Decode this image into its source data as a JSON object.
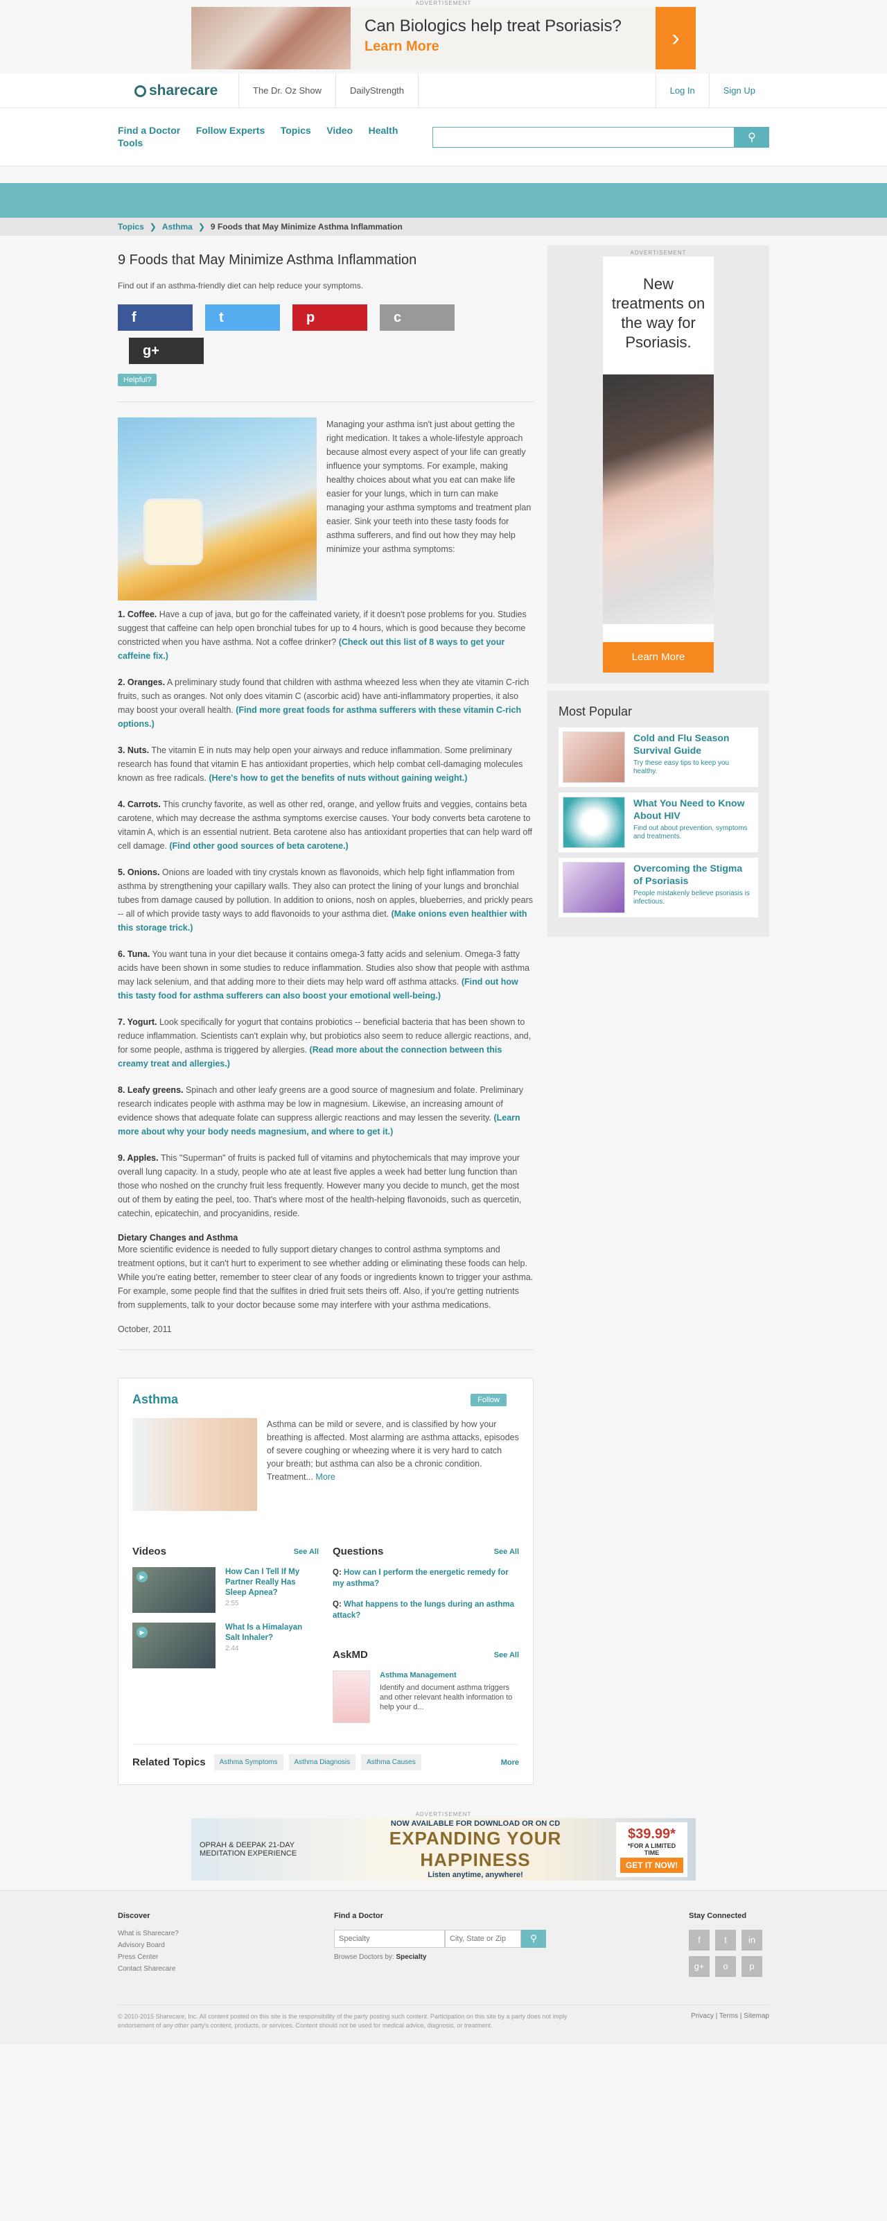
{
  "top_ad": {
    "tag": "ADVERTISEMENT",
    "headline": "Can Biologics help treat Psoriasis?",
    "cta": "Learn More",
    "arrow": "›"
  },
  "header": {
    "logo": "sharecare",
    "links": [
      "The Dr. Oz Show",
      "DailyStrength"
    ],
    "login": "Log In",
    "signup": "Sign Up"
  },
  "nav": {
    "items": [
      "Find a Doctor",
      "Follow Experts",
      "Topics",
      "Video",
      "Health Tools"
    ],
    "search_placeholder": "",
    "search_icon": "search-icon"
  },
  "breadcrumb": [
    "Topics",
    "Asthma",
    "9 Foods that May Minimize Asthma Inflammation"
  ],
  "article": {
    "title": "9 Foods that May Minimize Asthma Inflammation",
    "subtitle": "Find out if an asthma-friendly diet can help reduce your symptoms.",
    "share": {
      "facebook": "f",
      "twitter": "t",
      "pinterest": "p",
      "cc": "c",
      "gplus": "g+"
    },
    "helpful": "Helpful?",
    "intro": "Managing your asthma isn't just about getting the right medication. It takes a whole-lifestyle approach because almost every aspect of your life can greatly influence your symptoms. For example, making healthy choices about what you eat can make life easier for your lungs, which in turn can make managing your asthma symptoms and treatment plan easier. Sink your teeth into these tasty foods for asthma sufferers, and find out how they may help minimize your asthma symptoms:",
    "items": [
      {
        "head": "1. Coffee.",
        "text": " Have a cup of java, but go for the caffeinated variety, if it doesn't pose problems for you. Studies suggest that caffeine can help open bronchial tubes for up to 4 hours, which is good because they become constricted when you have asthma. Not a coffee drinker? ",
        "link": "(Check out this list of 8 ways to get your caffeine fix.)"
      },
      {
        "head": "2. Oranges.",
        "text": " A preliminary study found that children with asthma wheezed less when they ate vitamin C-rich fruits, such as oranges. Not only does vitamin C (ascorbic acid) have anti-inflammatory properties, it also may boost your overall health. ",
        "link": "(Find more great foods for asthma sufferers with these vitamin C-rich options.)"
      },
      {
        "head": "3. Nuts.",
        "text": " The vitamin E in nuts may help open your airways and reduce inflammation. Some preliminary research has found that vitamin E has antioxidant properties, which help combat cell-damaging molecules known as free radicals. ",
        "link": "(Here's how to get the benefits of nuts without gaining weight.)"
      },
      {
        "head": "4. Carrots.",
        "text": " This crunchy favorite, as well as other red, orange, and yellow fruits and veggies, contains beta carotene, which may decrease the asthma symptoms exercise causes. Your body converts beta carotene to vitamin A, which is an essential nutrient. Beta carotene also has antioxidant properties that can help ward off cell damage. ",
        "link": "(Find other good sources of beta carotene.)"
      },
      {
        "head": "5. Onions.",
        "text": " Onions are loaded with tiny crystals known as flavonoids, which help fight inflammation from asthma by strengthening your capillary walls. They also can protect the lining of your lungs and bronchial tubes from damage caused by pollution. In addition to onions, nosh on apples, blueberries, and prickly pears -- all of which provide tasty ways to add flavonoids to your asthma diet. ",
        "link": "(Make onions even healthier with this storage trick.)"
      },
      {
        "head": "6. Tuna.",
        "text": " You want tuna in your diet because it contains omega-3 fatty acids and selenium. Omega-3 fatty acids have been shown in some studies to reduce inflammation. Studies also show that people with asthma may lack selenium, and that adding more to their diets may help ward off asthma attacks. ",
        "link": "(Find out how this tasty food for asthma sufferers can also boost your emotional well-being.)"
      },
      {
        "head": "7. Yogurt.",
        "text": " Look specifically for yogurt that contains probiotics -- beneficial bacteria that has been shown to reduce inflammation. Scientists can't explain why, but probiotics also seem to reduce allergic reactions, and, for some people, asthma is triggered by allergies. ",
        "link": "(Read more about the connection between this creamy treat and allergies.)"
      },
      {
        "head": "8. Leafy greens.",
        "text": " Spinach and other leafy greens are a good source of magnesium and folate. Preliminary research indicates people with asthma may be low in magnesium. Likewise, an increasing amount of evidence shows that adequate folate can suppress allergic reactions and may lessen the severity. ",
        "link": "(Learn more about why your body needs magnesium, and where to get it.)"
      },
      {
        "head": "9. Apples.",
        "text": " This \"Superman\" of fruits is packed full of vitamins and phytochemicals that may improve your overall lung capacity. In a study, people who ate at least five apples a week had better lung function than those who noshed on the crunchy fruit less frequently. However many you decide to munch, get the most out of them by eating the peel, too. That's where most of the health-helping flavonoids, such as quercetin, catechin, epicatechin, and procyanidins, reside.",
        "link": ""
      }
    ],
    "dietary_head": "Dietary Changes and Asthma",
    "dietary_text": "More scientific evidence is needed to fully support dietary changes to control asthma symptoms and treatment options, but it can't hurt to experiment to see whether adding or eliminating these foods can help. While you're eating better, remember to steer clear of any foods or ingredients known to trigger your asthma. For example, some people find that the sulfites in dried fruit sets theirs off. Also, if you're getting nutrients from supplements, talk to your doctor because some may interfere with your asthma medications.",
    "date": "October, 2011"
  },
  "topic": {
    "title": "Asthma",
    "follow": "Follow",
    "desc": "Asthma can be mild or severe, and is classified by how your breathing is affected. Most alarming are asthma attacks, episodes of severe coughing or wheezing where it is very hard to catch your breath; but asthma can also be a chronic condition. Treatment...",
    "more": "More",
    "videos_head": "Videos",
    "see_all": "See All",
    "videos": [
      {
        "title": "How Can I Tell If My Partner Really Has Sleep Apnea?",
        "dur": "2:55"
      },
      {
        "title": "What Is a Himalayan Salt Inhaler?",
        "dur": "2:44"
      }
    ],
    "questions_head": "Questions",
    "questions": [
      "How can I perform the energetic remedy for my asthma?",
      "What happens to the lungs during an asthma attack?"
    ],
    "askmd_head": "AskMD",
    "askmd": {
      "title": "Asthma Management",
      "desc": "Identify and document asthma triggers and other relevant health information to help your d..."
    },
    "related_head": "Related Topics",
    "related": [
      "Asthma Symptoms",
      "Asthma Diagnosis",
      "Asthma Causes"
    ],
    "related_more": "More"
  },
  "sidebar": {
    "ad_tag": "ADVERTISEMENT",
    "ad_text": "New treatments on the way for Psoriasis.",
    "ad_cta": "Learn More",
    "popular_head": "Most Popular",
    "popular": [
      {
        "title": "Cold and Flu Season Survival Guide",
        "desc": "Try these easy tips to keep you healthy."
      },
      {
        "title": "What You Need to Know About HIV",
        "desc": "Find out about prevention, symptoms and treatments."
      },
      {
        "title": "Overcoming the Stigma of Psoriasis",
        "desc": "People mistakenly believe psoriasis is infectious."
      }
    ]
  },
  "bottom_ad": {
    "tag": "ADVERTISEMENT",
    "left": "OPRAH & DEEPAK 21-DAY MEDITATION EXPERIENCE",
    "top": "NOW AVAILABLE FOR DOWNLOAD OR ON CD",
    "big": "EXPANDING YOUR HAPPINESS",
    "listen": "Listen anytime, anywhere!",
    "price": "$39.99*",
    "limited": "*FOR A LIMITED TIME",
    "get": "GET IT NOW!"
  },
  "footer": {
    "discover_head": "Discover",
    "discover": [
      "What is Sharecare?",
      "Advisory Board",
      "Press Center",
      "Contact Sharecare"
    ],
    "doctor_head": "Find a Doctor",
    "specialty_placeholder": "Specialty",
    "location_placeholder": "City, State or Zip",
    "browse": "Browse Doctors by:",
    "browse_bold": "Specialty",
    "connected_head": "Stay Connected",
    "social": [
      "f",
      "t",
      "in",
      "g+",
      "o",
      "p"
    ],
    "copyright": "© 2010-2015 Sharecare, Inc. All content posted on this site is the responsibility of the party posting such content. Participation on this site by a party does not imply endorsement of any other party's content, products, or services. Content should not be used for medical advice, diagnosis, or treatment.",
    "links": "Privacy | Terms | Sitemap"
  }
}
